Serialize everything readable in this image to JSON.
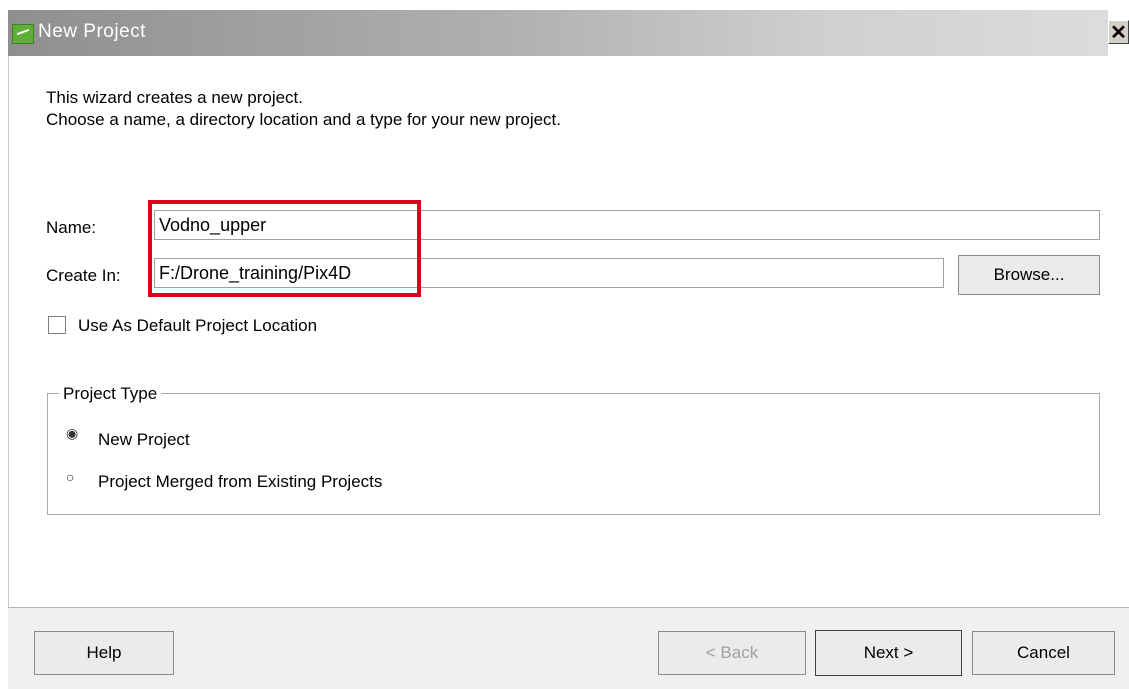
{
  "window": {
    "title": "New Project",
    "close_glyph": "✕"
  },
  "description": {
    "line1": "This wizard creates a new project.",
    "line2": "Choose a name, a directory location and a type for your new project."
  },
  "form": {
    "name_label": "Name:",
    "name_value": "Vodno_upper",
    "create_in_label": "Create In:",
    "create_in_value": "F:/Drone_training/Pix4D",
    "browse_label": "Browse...",
    "default_location_label": "Use As Default Project Location",
    "default_location_checked": false
  },
  "project_type": {
    "title": "Project Type",
    "options": [
      {
        "label": "New Project",
        "selected": true
      },
      {
        "label": "Project Merged from Existing Projects",
        "selected": false
      }
    ]
  },
  "buttons": {
    "help": "Help",
    "back": "< Back",
    "next": "Next >",
    "cancel": "Cancel"
  },
  "colors": {
    "highlight": "#e0001b",
    "app_icon": "#5fae3c"
  },
  "icons": {
    "app": "pix4d-app-icon",
    "close": "close-icon",
    "radio_selected": "◉",
    "radio_unselected": "○"
  }
}
